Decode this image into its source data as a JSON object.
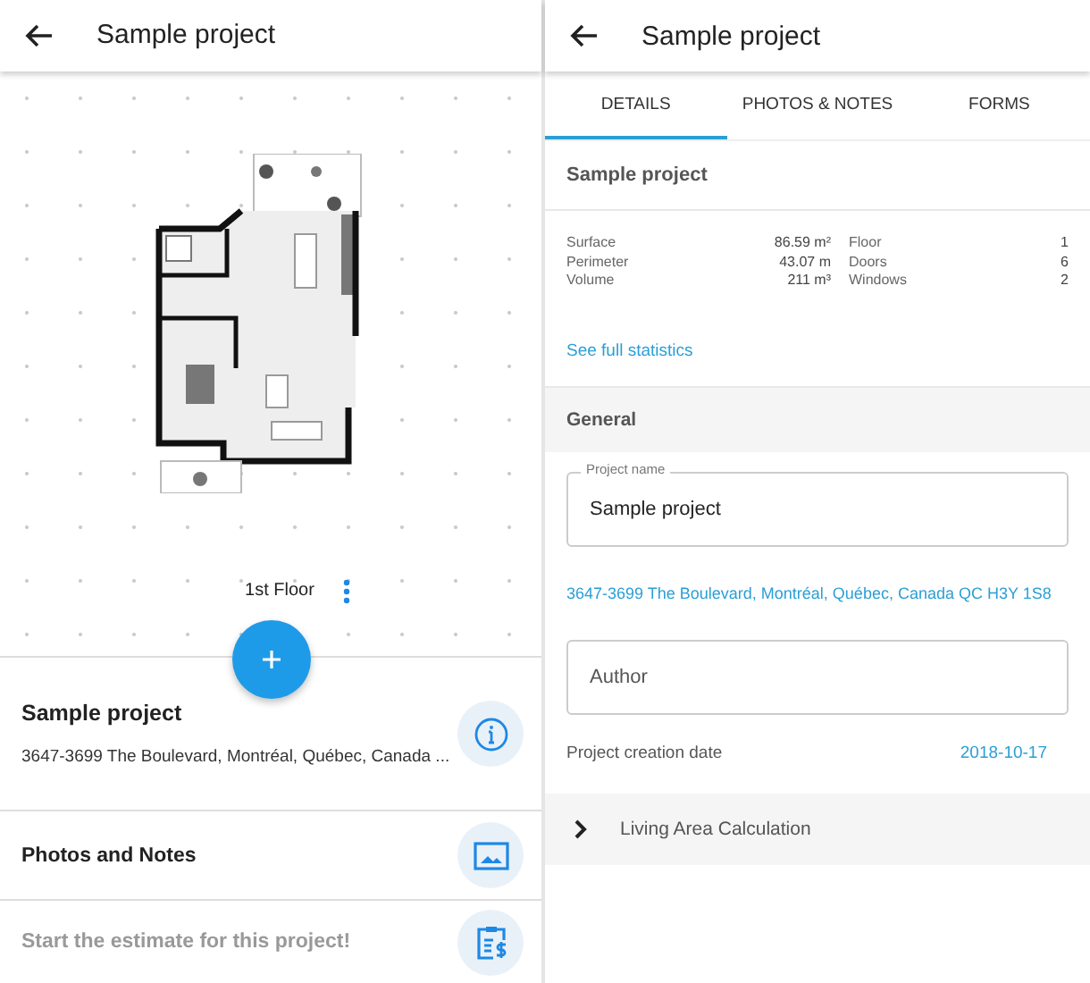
{
  "left": {
    "header": {
      "title": "Sample project"
    },
    "floor_plan": {
      "floor_label": "1st Floor"
    },
    "items": [
      {
        "kind": "info",
        "title": "Sample project",
        "subtitle": "3647-3699 The Boulevard, Montréal, Québec, Canada ..."
      },
      {
        "kind": "photos",
        "title": "Photos and Notes"
      },
      {
        "kind": "estimate",
        "title": "Start the estimate for this project!"
      }
    ]
  },
  "right": {
    "header": {
      "title": "Sample project"
    },
    "tabs": [
      {
        "label": "DETAILS",
        "selected": true
      },
      {
        "label": "PHOTOS & NOTES",
        "selected": false
      },
      {
        "label": "FORMS",
        "selected": false
      }
    ],
    "project_title": "Sample project",
    "stats": [
      {
        "label": "Surface",
        "value": "86.59 m²"
      },
      {
        "label": "Floor",
        "value": "1"
      },
      {
        "label": "Perimeter",
        "value": "43.07 m"
      },
      {
        "label": "Doors",
        "value": "6"
      },
      {
        "label": "Volume",
        "value": "211 m³"
      },
      {
        "label": "Windows",
        "value": "2"
      }
    ],
    "stats_link": "See full statistics",
    "section": "General",
    "name_field": {
      "label": "Project name",
      "value": "Sample project"
    },
    "address": "3647-3699 The Boulevard, Montréal, Québec, Canada QC H3Y 1S8",
    "author_field": {
      "placeholder": "Author"
    },
    "creation": {
      "label": "Project creation date",
      "value": "2018-10-17"
    },
    "expander": {
      "label": "Living Area Calculation",
      "expanded": false
    }
  }
}
